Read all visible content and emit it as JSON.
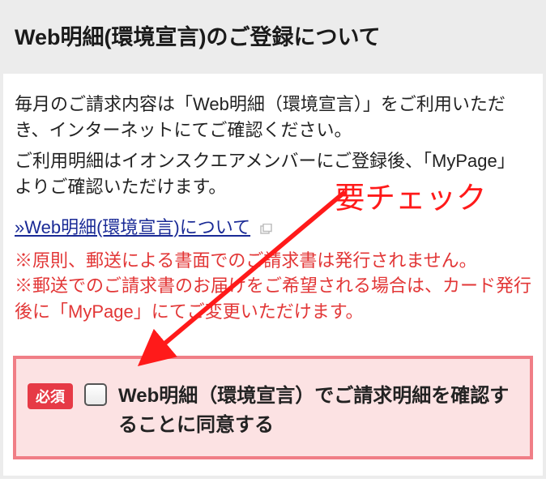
{
  "header": {
    "title": "Web明細(環境宣言)のご登録について"
  },
  "body": {
    "para1": "毎月のご請求内容は「Web明細（環境宣言）」をご利用いただき、インターネットにてご確認ください。",
    "para2": "ご利用明細はイオンスクエアメンバーにご登録後、「MyPage」よりご確認いただけます。",
    "link_text": "»Web明細(環境宣言)について",
    "note1": "※原則、郵送による書面でのご請求書は発行されません。",
    "note2": "※郵送でのご請求書のお届けをご希望される場合は、カード発行後に「MyPage」にてご変更いただけます。"
  },
  "consent": {
    "required_badge": "必須",
    "checkbox_checked": false,
    "label": "Web明細（環境宣言）でご請求明細を確認することに同意する"
  },
  "annotation": {
    "text": "要チェック"
  },
  "colors": {
    "accent_red": "#e63a46",
    "note_red": "#e23636",
    "panel_border": "#f07e86",
    "panel_bg": "#fce2e3",
    "link": "#1a2a96",
    "anno": "#ff1a1a"
  }
}
